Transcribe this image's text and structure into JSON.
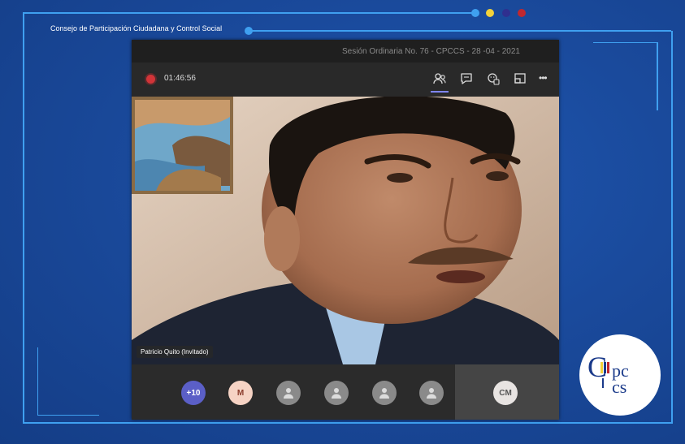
{
  "organization": {
    "title": "Consejo de Participación Ciudadana y Control Social"
  },
  "decor_colors": {
    "accent_line": "#3fa0f0",
    "dot1": "#3fa0f0",
    "dot2": "#f3d23a",
    "dot3": "#2f2f8f",
    "dot4": "#c0282f"
  },
  "meeting": {
    "title": "Sesión Ordinaria No. 76 - CPCCS - 28 -04 - 2021",
    "timer": "01:46:56",
    "recording_color": "#d13438"
  },
  "toolbar": {
    "icons": [
      "participants-icon",
      "chat-icon",
      "reactions-icon",
      "share-screen-icon",
      "more-options-icon"
    ],
    "more_label": "•••"
  },
  "video": {
    "speaker_name": "Patricio Quito (Invitado)"
  },
  "participants": {
    "more_count": "+10",
    "m_initial": "M",
    "cm_initials": "CM"
  },
  "logo": {
    "text": "Cpccs"
  }
}
